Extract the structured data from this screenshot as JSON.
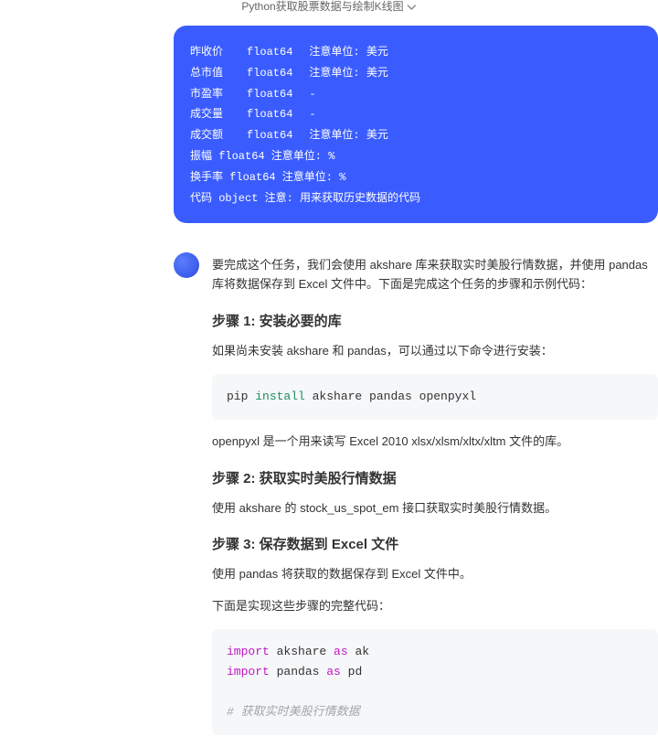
{
  "header": {
    "title": "Python获取股票数据与绘制K线图"
  },
  "user_msg": {
    "rows": [
      {
        "c1": "昨收价",
        "c2": "float64",
        "c3": "注意单位: 美元"
      },
      {
        "c1": "总市值",
        "c2": "float64",
        "c3": "注意单位: 美元"
      },
      {
        "c1": "市盈率",
        "c2": "float64",
        "c3": "-"
      },
      {
        "c1": "成交量",
        "c2": "float64",
        "c3": "-"
      },
      {
        "c1": "成交额",
        "c2": "float64",
        "c3": "注意单位: 美元"
      }
    ],
    "tail1": "振幅 float64    注意单位: %",
    "tail2": "换手率    float64    注意单位: %",
    "tail3": "代码 object    注意: 用来获取历史数据的代码"
  },
  "assistant": {
    "intro": "要完成这个任务，我们会使用 akshare 库来获取实时美股行情数据，并使用 pandas 库将数据保存到 Excel 文件中。下面是完成这个任务的步骤和示例代码：",
    "h1": "步骤 1: 安装必要的库",
    "p1": "如果尚未安装 akshare 和 pandas，可以通过以下命令进行安装：",
    "code1": {
      "pre": "pip ",
      "kw": "install",
      "post": " akshare pandas openpyxl"
    },
    "p2": "openpyxl 是一个用来读写 Excel 2010 xlsx/xlsm/xltx/xltm 文件的库。",
    "h2": "步骤 2: 获取实时美股行情数据",
    "p3": "使用 akshare 的 stock_us_spot_em 接口获取实时美股行情数据。",
    "h3": "步骤 3: 保存数据到 Excel 文件",
    "p4": "使用 pandas 将获取的数据保存到 Excel 文件中。",
    "p5": "下面是实现这些步骤的完整代码：",
    "code2": {
      "l1_kw": "import",
      "l1_mod": " akshare ",
      "l1_as": "as",
      "l1_al": " ak",
      "l2_kw": "import",
      "l2_mod": " pandas ",
      "l2_as": "as",
      "l2_al": " pd",
      "l3_cmt": "# 获取实时美股行情数据"
    }
  }
}
